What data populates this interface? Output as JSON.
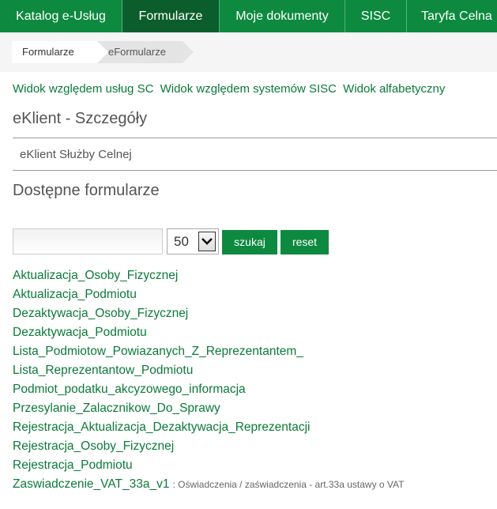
{
  "nav": {
    "items": [
      {
        "label": "Katalog e-Usług",
        "active": false
      },
      {
        "label": "Formularze",
        "active": true
      },
      {
        "label": "Moje dokumenty",
        "active": false
      },
      {
        "label": "SISC",
        "active": false
      },
      {
        "label": "Taryfa Celna",
        "active": false
      }
    ]
  },
  "breadcrumb": {
    "items": [
      "Formularze",
      "eFormularze"
    ]
  },
  "view_links": [
    "Widok względem usług SC",
    "Widok względem systemów SISC",
    "Widok alfabetyczny"
  ],
  "details": {
    "title": "eKlient - Szczegóły",
    "subtitle": "eKlient Służby Celnej"
  },
  "forms_section": {
    "title": "Dostępne formularze",
    "search_value": "",
    "page_size": "50",
    "search_label": "szukaj",
    "reset_label": "reset"
  },
  "forms": [
    {
      "name": "Aktualizacja_Osoby_Fizycznej",
      "desc": ""
    },
    {
      "name": "Aktualizacja_Podmiotu",
      "desc": ""
    },
    {
      "name": "Dezaktywacja_Osoby_Fizycznej",
      "desc": ""
    },
    {
      "name": "Dezaktywacja_Podmiotu",
      "desc": ""
    },
    {
      "name": "Lista_Podmiotow_Powiazanych_Z_Reprezentantem_",
      "desc": ""
    },
    {
      "name": "Lista_Reprezentantow_Podmiotu",
      "desc": ""
    },
    {
      "name": "Podmiot_podatku_akcyzowego_informacja",
      "desc": ""
    },
    {
      "name": "Przesylanie_Zalacznikow_Do_Sprawy",
      "desc": ""
    },
    {
      "name": "Rejestracja_Aktualizacja_Dezaktywacja_Reprezentacji",
      "desc": ""
    },
    {
      "name": "Rejestracja_Osoby_Fizycznej",
      "desc": ""
    },
    {
      "name": "Rejestracja_Podmiotu",
      "desc": ""
    },
    {
      "name": "Zaswiadczenie_VAT_33a_v1",
      "desc": ": Oświadczenia / zaświadczenia - art.33a ustawy o VAT"
    }
  ],
  "colors": {
    "brand_green": "#0d8a3f",
    "active_nav": "#0b5e2c",
    "link_green": "#0b7a39"
  }
}
